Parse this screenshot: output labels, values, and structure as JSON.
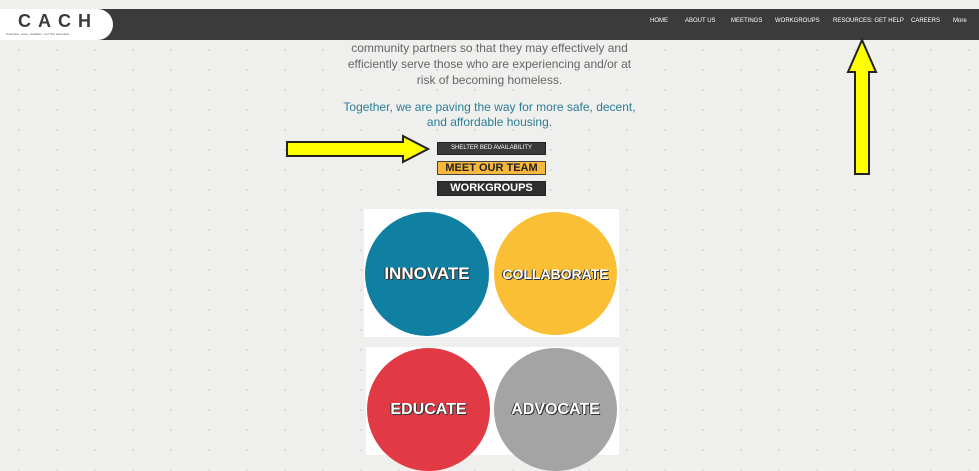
{
  "header": {
    "logo_text": "CACH",
    "logo_tagline": "Columbia - Area - Coalition - For The Homeless",
    "nav": [
      "HOME",
      "ABOUT US",
      "MEETINGS",
      "WORKGROUPS",
      "RESOURCES: GET HELP",
      "CAREERS",
      "More"
    ]
  },
  "intro": {
    "line1": "community partners so that they may effectively and",
    "line2": "efficiently serve those who are experiencing and/or at",
    "line3": "risk of becoming homeless.",
    "tagline1": "Together, we are paving the way for more safe, decent,",
    "tagline2": "and affordable housing."
  },
  "buttons": {
    "shelter": "SHELTER BED AVAILABILITY",
    "team": "MEET OUR TEAM",
    "workgroups": "WORKGROUPS"
  },
  "circles": {
    "innovate": "INNOVATE",
    "collaborate": "COLLABORATE",
    "educate": "EDUCATE",
    "advocate": "ADVOCATE"
  },
  "colors": {
    "topbar": "#3b3b3b",
    "innovate": "#0f7fa2",
    "collaborate": "#fbbf36",
    "educate": "#e23a44",
    "advocate": "#a4a4a4",
    "arrow": "#ffff00"
  }
}
